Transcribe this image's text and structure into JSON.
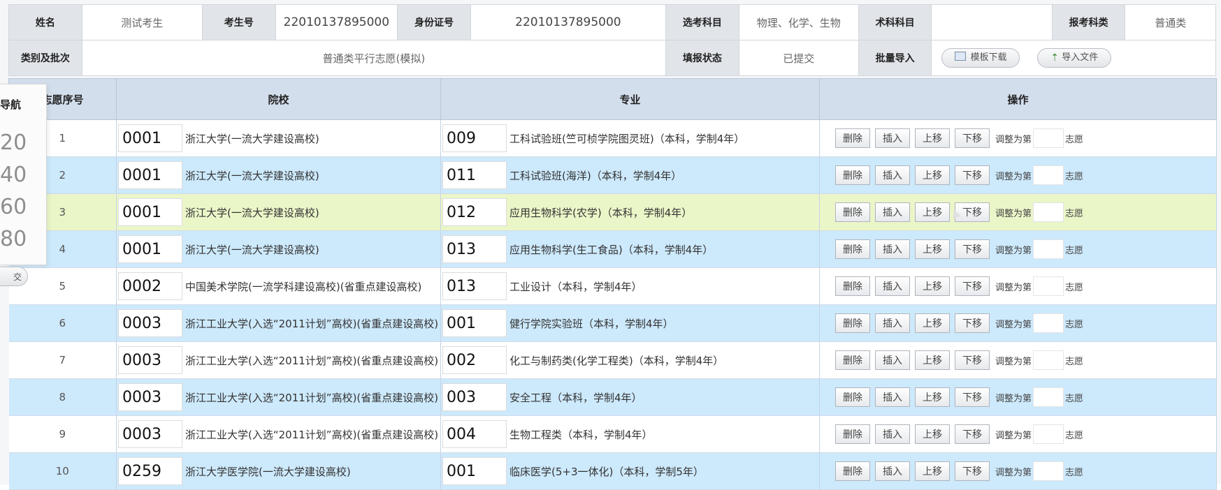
{
  "info": {
    "row1": {
      "name_label": "姓名",
      "name_value": "测试考生",
      "exam_no_label": "考生号",
      "exam_no_value": "22010137895000",
      "id_label": "身份证号",
      "id_value": "22010137895000",
      "subjects_label": "选考科目",
      "subjects_value": "物理、化学、生物",
      "skill_label": "术科科目",
      "skill_value": "",
      "category_label": "报考科类",
      "category_value": "普通类"
    },
    "row2": {
      "batch_label": "类别及批次",
      "batch_value": "普通类平行志愿(模拟)",
      "status_label": "填报状态",
      "status_value": "已提交",
      "import_label": "批量导入",
      "template_button": "模板下载",
      "import_button": "导入文件"
    }
  },
  "table": {
    "headers": {
      "seq": "志愿序号",
      "school": "院校",
      "major": "专业",
      "ops": "操作"
    },
    "op_labels": {
      "delete": "删除",
      "insert": "插入",
      "up": "上移",
      "down": "下移",
      "adjust": "调整为第",
      "unit": "志愿"
    },
    "rows": [
      {
        "seq": "1",
        "school_code": "0001",
        "school": "浙江大学(一流大学建设高校)",
        "major_code": "009",
        "major": "工科试验班(竺可桢学院图灵班)（本科，学制4年）"
      },
      {
        "seq": "2",
        "school_code": "0001",
        "school": "浙江大学(一流大学建设高校)",
        "major_code": "011",
        "major": "工科试验班(海洋)（本科，学制4年）"
      },
      {
        "seq": "3",
        "school_code": "0001",
        "school": "浙江大学(一流大学建设高校)",
        "major_code": "012",
        "major": "应用生物科学(农学)（本科，学制4年）"
      },
      {
        "seq": "4",
        "school_code": "0001",
        "school": "浙江大学(一流大学建设高校)",
        "major_code": "013",
        "major": "应用生物科学(生工食品)（本科，学制4年）"
      },
      {
        "seq": "5",
        "school_code": "0002",
        "school": "中国美术学院(一流学科建设高校)(省重点建设高校)",
        "major_code": "013",
        "major": "工业设计（本科，学制4年）"
      },
      {
        "seq": "6",
        "school_code": "0003",
        "school": "浙江工业大学(入选“2011计划”高校)(省重点建设高校)",
        "major_code": "001",
        "major": "健行学院实验班（本科，学制4年）"
      },
      {
        "seq": "7",
        "school_code": "0003",
        "school": "浙江工业大学(入选“2011计划”高校)(省重点建设高校)",
        "major_code": "002",
        "major": "化工与制药类(化学工程类)（本科，学制4年）"
      },
      {
        "seq": "8",
        "school_code": "0003",
        "school": "浙江工业大学(入选“2011计划”高校)(省重点建设高校)",
        "major_code": "003",
        "major": "安全工程（本科，学制4年）"
      },
      {
        "seq": "9",
        "school_code": "0003",
        "school": "浙江工业大学(入选“2011计划”高校)(省重点建设高校)",
        "major_code": "004",
        "major": "生物工程类（本科，学制4年）"
      },
      {
        "seq": "10",
        "school_code": "0259",
        "school": "浙江大学医学院(一流大学建设高校)",
        "major_code": "001",
        "major": "临床医学(5+3一体化)（本科，学制5年）"
      }
    ]
  },
  "float_nav": {
    "title": "导航",
    "numbers": [
      "20",
      "40",
      "60",
      "80"
    ],
    "pill_label": "交"
  }
}
